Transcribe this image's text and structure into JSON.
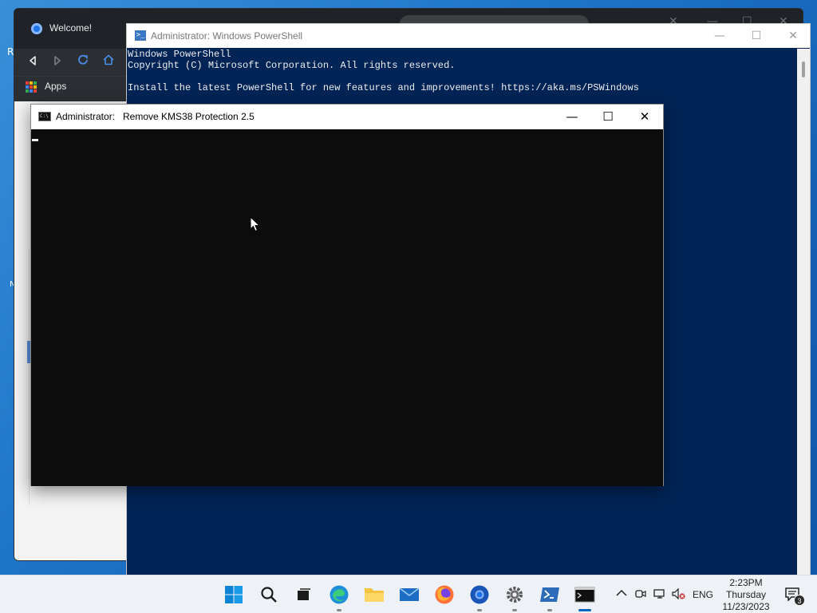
{
  "desktop": {
    "edge_chars": [
      "R",
      "N"
    ]
  },
  "browser": {
    "tab_title": "Welcome!",
    "bookmarks": {
      "apps_label": "Apps"
    },
    "icons": {
      "back": "back-arrow-icon",
      "forward": "forward-arrow-icon",
      "reload": "reload-icon",
      "home": "home-icon"
    }
  },
  "powershell": {
    "title": "Administrator: Windows PowerShell",
    "console_lines": [
      "Windows PowerShell",
      "Copyright (C) Microsoft Corporation. All rights reserved.",
      "",
      "Install the latest PowerShell for new features and improvements! https://aka.ms/PSWindows"
    ],
    "background_color": "#012456",
    "text_color": "#eeedf0"
  },
  "cmd_window": {
    "title_prefix": "Administrator:",
    "title_name": "Remove KMS38 Protection 2.5",
    "background_color": "#0c0c0c"
  },
  "taskbar": {
    "apps": [
      {
        "name": "start",
        "icon": "windows-logo-icon"
      },
      {
        "name": "search",
        "icon": "search-icon"
      },
      {
        "name": "task-view",
        "icon": "task-view-icon"
      },
      {
        "name": "edge",
        "icon": "edge-icon"
      },
      {
        "name": "file-explorer",
        "icon": "folder-icon"
      },
      {
        "name": "mail",
        "icon": "mail-icon"
      },
      {
        "name": "firefox",
        "icon": "firefox-icon"
      },
      {
        "name": "chrome-like",
        "icon": "browser-icon"
      },
      {
        "name": "settings",
        "icon": "gear-icon"
      },
      {
        "name": "powershell",
        "icon": "powershell-icon"
      },
      {
        "name": "command-prompt",
        "icon": "cmd-icon"
      }
    ],
    "tray": {
      "language": "ENG",
      "time": "2:23PM",
      "day": "Thursday",
      "date": "11/23/2023",
      "notification_count": "3"
    }
  }
}
